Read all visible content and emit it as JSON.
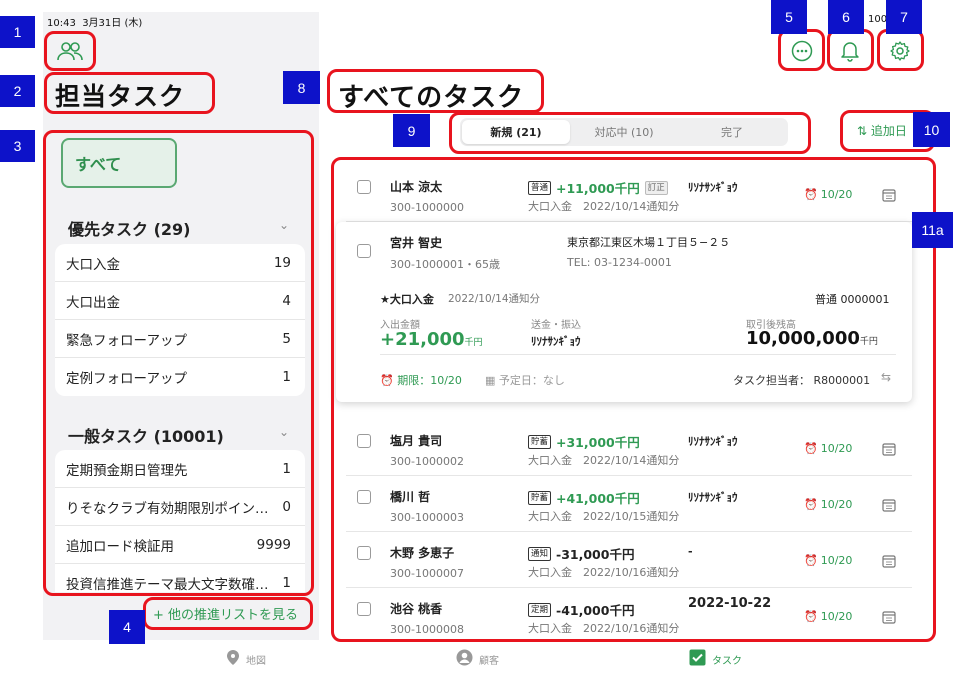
{
  "status_bar": {
    "time": "10:43",
    "date": "3月31日 (木)",
    "battery": "100"
  },
  "left": {
    "title": "担当タスク",
    "all_button": "すべて",
    "priority_group": {
      "header": "優先タスク (29)",
      "items": [
        {
          "label": "大口入金",
          "count": "19"
        },
        {
          "label": "大口出金",
          "count": "4"
        },
        {
          "label": "緊急フォローアップ",
          "count": "5"
        },
        {
          "label": "定例フォローアップ",
          "count": "1"
        }
      ]
    },
    "general_group": {
      "header": "一般タスク (10001)",
      "items": [
        {
          "label": "定期預金期日管理先",
          "count": "1"
        },
        {
          "label": "りそなクラブ有効期限別ポイン…",
          "count": "0"
        },
        {
          "label": "追加ロード検証用",
          "count": "9999"
        },
        {
          "label": "投資信推進テーマ最大文字数確…",
          "count": "1"
        }
      ]
    },
    "more_link": "+ 他の推進リストを見る"
  },
  "main": {
    "title": "すべてのタスク",
    "tabs": [
      {
        "label": "新規 (21)",
        "active": true
      },
      {
        "label": "対応中 (10)",
        "active": false
      },
      {
        "label": "完了",
        "active": false
      }
    ],
    "sort_label": "追加日",
    "rows": [
      {
        "name": "山本 涼太",
        "id": "300-1000000",
        "tag": "普通",
        "amount": "+11,000千円",
        "extra_tag": "訂正",
        "sub": "大口入金　2022/10/14通知分",
        "kana": "ﾘｿﾅｻﾝｷﾞｮｳ",
        "due": "10/20",
        "positive": true
      },
      {
        "name": "塩月 貴司",
        "id": "300-1000002",
        "tag": "貯蓄",
        "amount": "+31,000千円",
        "extra_tag": "",
        "sub": "大口入金　2022/10/14通知分",
        "kana": "ﾘｿﾅｻﾝｷﾞｮｳ",
        "due": "10/20",
        "positive": true
      },
      {
        "name": "橋川 哲",
        "id": "300-1000003",
        "tag": "貯蓄",
        "amount": "+41,000千円",
        "extra_tag": "",
        "sub": "大口入金　2022/10/15通知分",
        "kana": "ﾘｿﾅｻﾝｷﾞｮｳ",
        "due": "10/20",
        "positive": true
      },
      {
        "name": "木野 多恵子",
        "id": "300-1000007",
        "tag": "通知",
        "amount": "-31,000千円",
        "extra_tag": "",
        "sub": "大口入金　2022/10/16通知分",
        "kana": "-",
        "due": "10/20",
        "positive": false
      },
      {
        "name": "池谷 桃香",
        "id": "300-1000008",
        "tag": "定期",
        "amount": "-41,000千円",
        "extra_tag": "",
        "sub": "大口入金　2022/10/16通知分",
        "kana": "2022-10-22",
        "due": "10/20",
        "positive": false
      }
    ],
    "detail": {
      "name": "宮井 智史",
      "id_age": "300-1000001・65歳",
      "address": "東京都江東区木場１丁目５−２５",
      "tel": "TEL: 03-1234-0001",
      "task_type": "★大口入金",
      "notice": "2022/10/14通知分",
      "account": "普通 0000001",
      "amount_label": "入出金額",
      "amount": "+21,000",
      "amount_unit": "千円",
      "transfer_label": "送金・振込",
      "transfer_value": "ﾘｿﾅｻﾝｷﾞｮｳ",
      "balance_label": "取引後残高",
      "balance": "10,000,000",
      "balance_unit": "千円",
      "deadline": "期限：10/20",
      "scheduled": "予定日：なし",
      "assignee_label": "タスク担当者：",
      "assignee": "R8000001"
    }
  },
  "bottom_nav": [
    {
      "label": "地図",
      "icon": "map-pin-icon"
    },
    {
      "label": "顧客",
      "icon": "user-icon"
    },
    {
      "label": "タスク",
      "icon": "checkbox-icon",
      "active": true
    }
  ],
  "annotations": [
    "1",
    "2",
    "3",
    "4",
    "5",
    "6",
    "7",
    "8",
    "9",
    "10",
    "11a"
  ],
  "colors": {
    "accent": "#2f9a53",
    "annotation_box": "#e8141e",
    "annotation_label": "#0d12c9"
  }
}
